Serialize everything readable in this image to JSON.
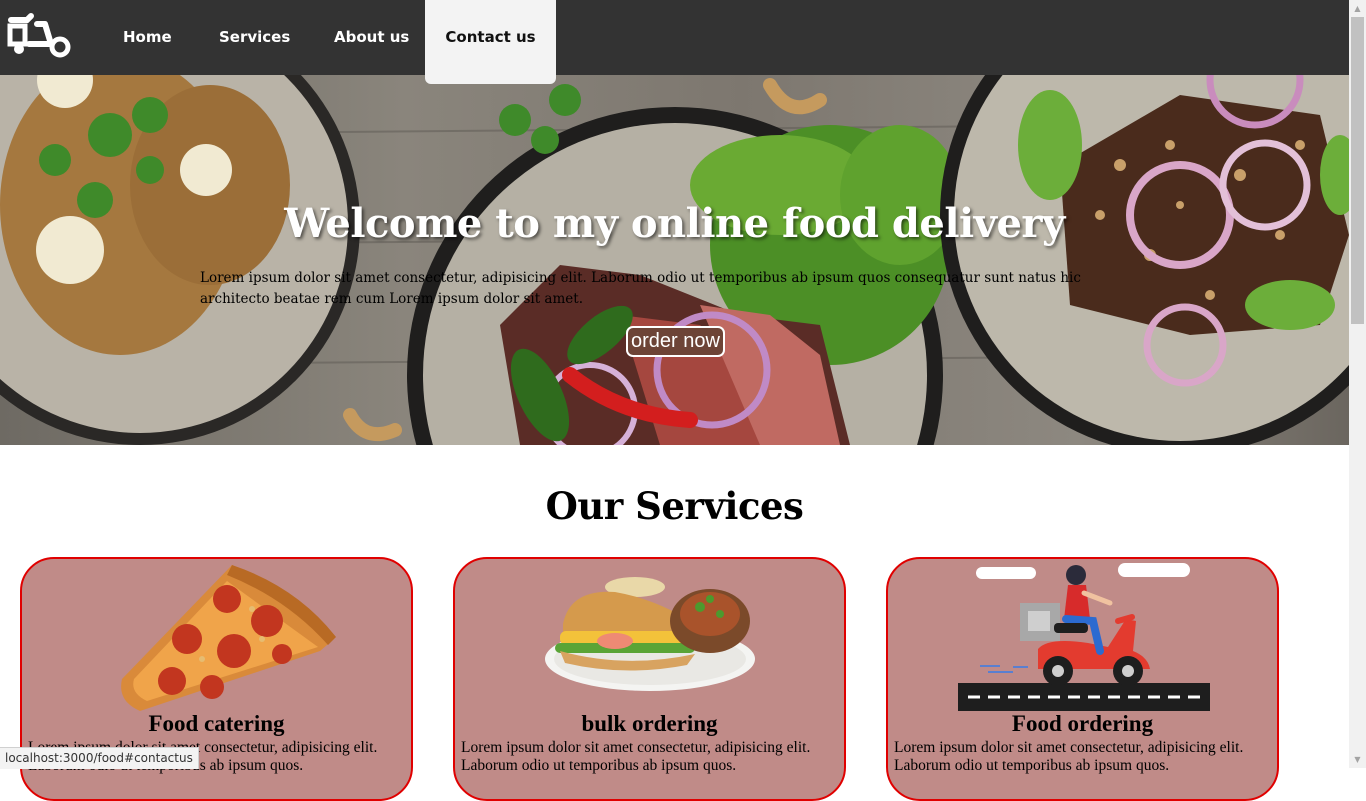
{
  "nav": {
    "logo_icon": "scooter-logo-icon",
    "items": [
      {
        "label": "Home"
      },
      {
        "label": "Services"
      },
      {
        "label": "About us"
      },
      {
        "label": "Contact us",
        "active": true
      }
    ]
  },
  "hero": {
    "title": "Welcome to my online food delivery",
    "text": "Lorem ipsum dolor sit amet consectetur, adipisicing elit. Laborum odio ut temporibus ab ipsum quos consequatur sunt natus hic architecto beatae rem cum Lorem ipsum dolor sit amet.",
    "button_label": "order now"
  },
  "services": {
    "title": "Our Services",
    "cards": [
      {
        "image": "pizza-slice-image",
        "title": "Food catering",
        "text": "Lorem ipsum dolor sit amet consectetur, adipisicing elit. Laborum odio ut temporibus ab ipsum quos."
      },
      {
        "image": "burger-plate-image",
        "title": "bulk ordering",
        "text": "Lorem ipsum dolor sit amet consectetur, adipisicing elit. Laborum odio ut temporibus ab ipsum quos."
      },
      {
        "image": "delivery-scooter-image",
        "title": "Food ordering",
        "text": "Lorem ipsum dolor sit amet consectetur, adipisicing elit. Laborum odio ut temporibus ab ipsum quos."
      }
    ]
  },
  "status_bar": {
    "url": "localhost:3000/food#contactus"
  },
  "colors": {
    "nav_bg": "#333333",
    "card_bg": "#c08b88",
    "card_border": "#e00000",
    "button_bg": "#6d4437"
  }
}
